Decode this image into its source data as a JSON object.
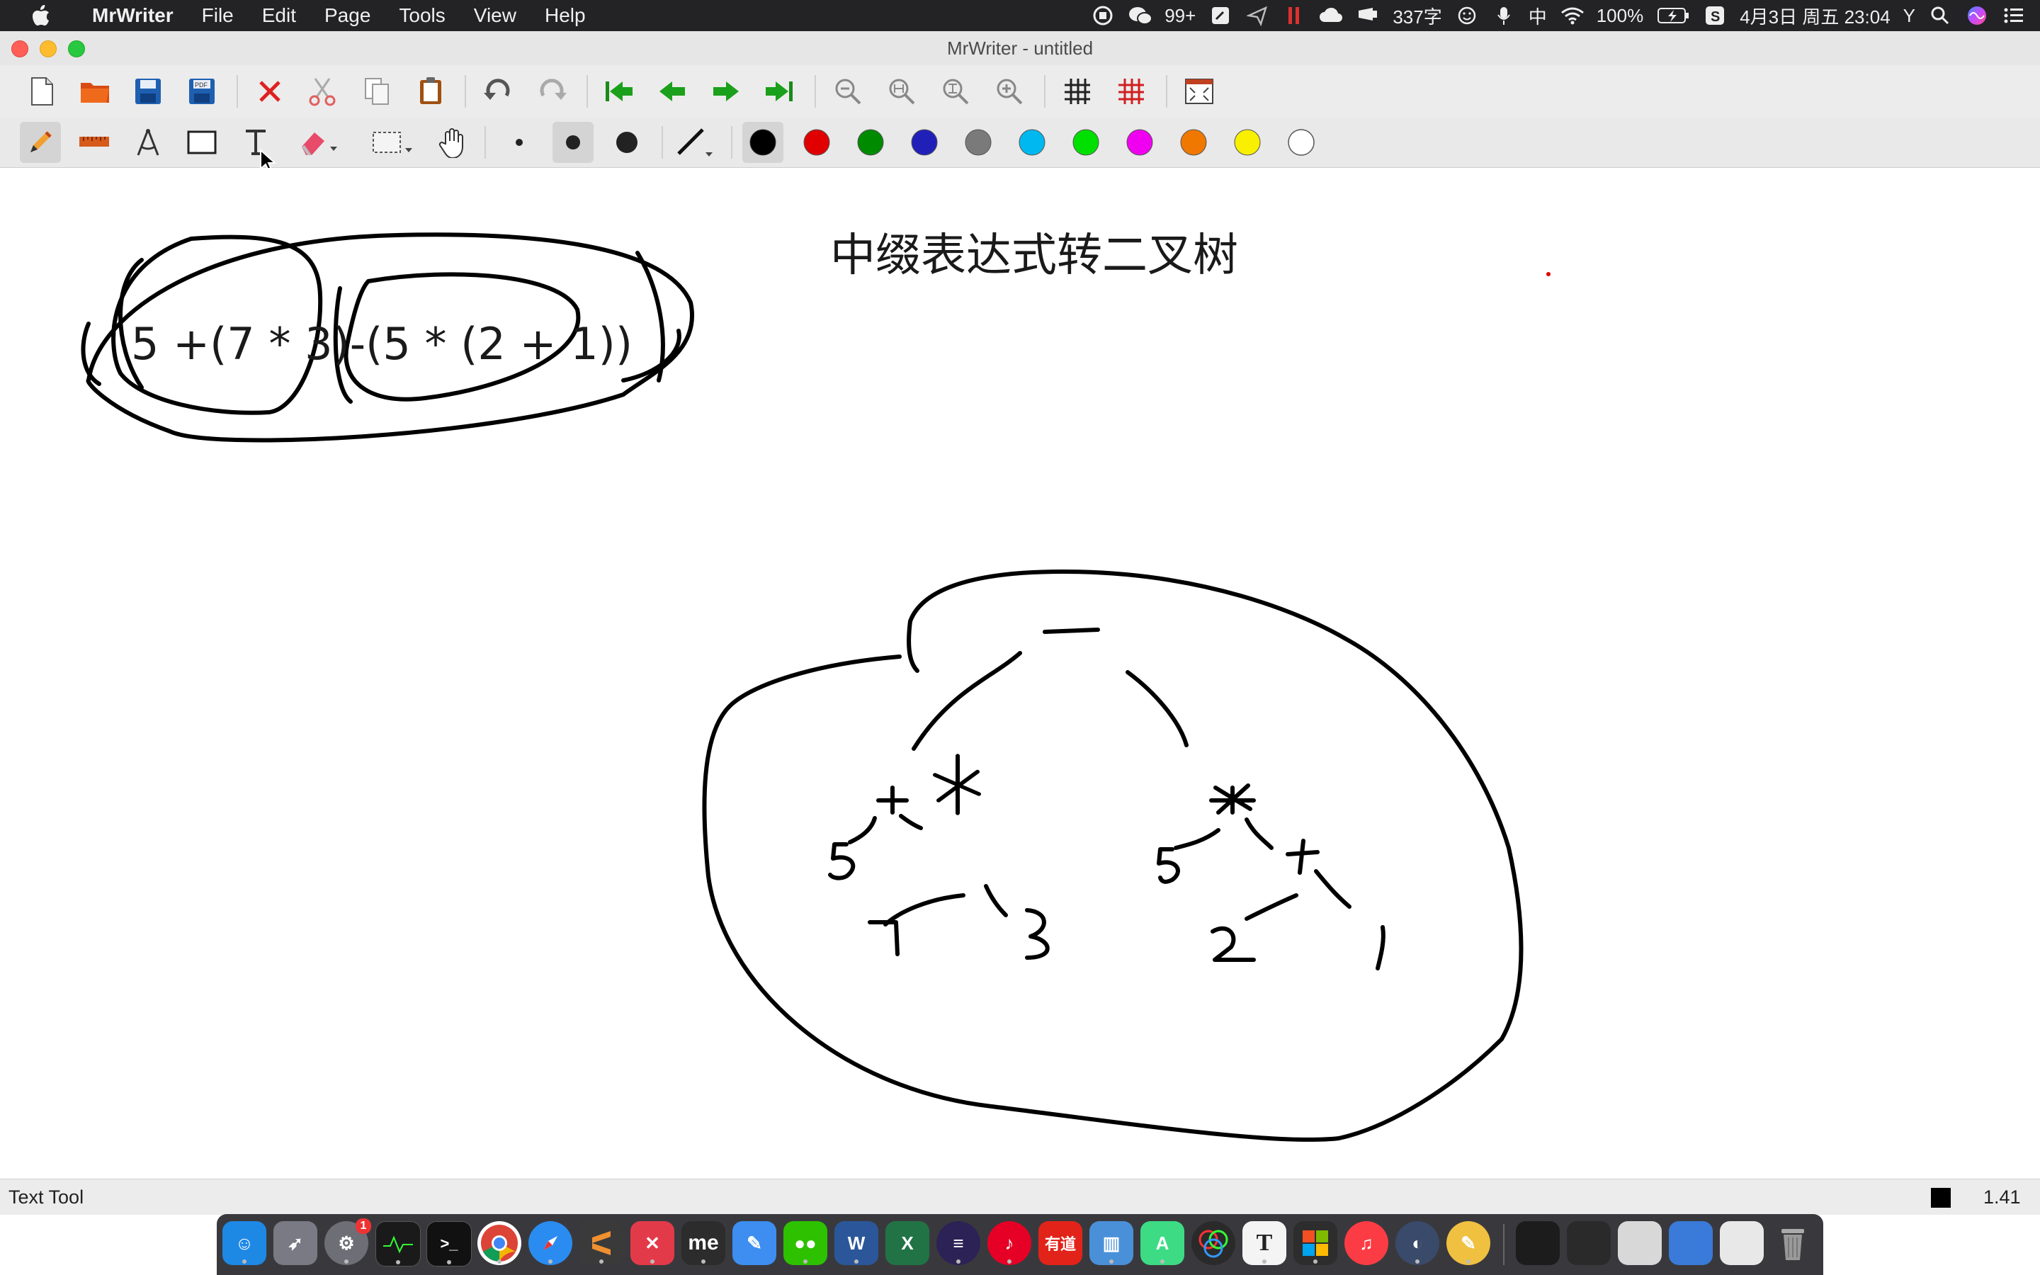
{
  "menubar": {
    "app_name": "MrWriter",
    "menus": [
      "File",
      "Edit",
      "Page",
      "Tools",
      "View",
      "Help"
    ],
    "status": {
      "wechat_count": "99+",
      "word_count": "337字",
      "input_method": "中",
      "battery": "100%",
      "datetime": "4月3日 周五 23:04",
      "user_initial": "Y"
    }
  },
  "window": {
    "title": "MrWriter - untitled"
  },
  "toolbar1": {
    "icons": [
      "new-document-icon",
      "open-folder-icon",
      "save-icon",
      "export-pdf-icon",
      "delete-icon",
      "cut-icon",
      "copy-icon",
      "paste-icon",
      "undo-icon",
      "redo-icon",
      "first-page-icon",
      "previous-page-icon",
      "next-page-icon",
      "last-page-icon",
      "zoom-out-icon",
      "zoom-fit-height-icon",
      "zoom-fit-width-icon",
      "zoom-in-icon",
      "grid-icon",
      "grid-red-icon",
      "fullscreen-icon"
    ]
  },
  "toolbar2": {
    "tools": [
      "pen-icon",
      "ruler-icon",
      "compass-icon",
      "rectangle-icon",
      "text-tool-icon",
      "eraser-icon",
      "selection-icon",
      "hand-icon"
    ],
    "pen_sizes": [
      "small",
      "medium",
      "large"
    ],
    "colors": [
      "#000000",
      "#e00000",
      "#008a00",
      "#2020b8",
      "#7a7a7a",
      "#00b8f0",
      "#00e000",
      "#f000f0",
      "#f07800",
      "#f8f000",
      "#ffffff"
    ],
    "selected_color": "#000000"
  },
  "canvas": {
    "title_text": "中缀表达式转二叉树",
    "expression": "5 +(7 * 3)-(5 *   (2 + 1))",
    "tree_nodes": {
      "root": "—",
      "plus_left": "+",
      "left_leaf": "5",
      "times_left": "*",
      "leaf_7": "7",
      "leaf_3": "3",
      "times_right": "*",
      "right_leaf_5": "5",
      "plus_right": "+",
      "leaf_2": "2",
      "leaf_1": "1"
    }
  },
  "statusbar": {
    "tool_name": "Text Tool",
    "zoom": "1.41"
  },
  "dock": {
    "apps": [
      "Finder",
      "Launchpad",
      "System Preferences",
      "Activity Monitor",
      "Terminal",
      "Chrome",
      "Safari",
      "Sublime Text",
      "XMind",
      "Mendeley",
      "Pencil",
      "WeChat",
      "Word",
      "Excel",
      "Eclipse",
      "NetEase Music",
      "Youdao",
      "Parallels",
      "Android Studio",
      "Pixelmator",
      "Typora",
      "Windows",
      "Music",
      "Proxy",
      "MrWriter"
    ],
    "system_prefs_badge": "1"
  }
}
